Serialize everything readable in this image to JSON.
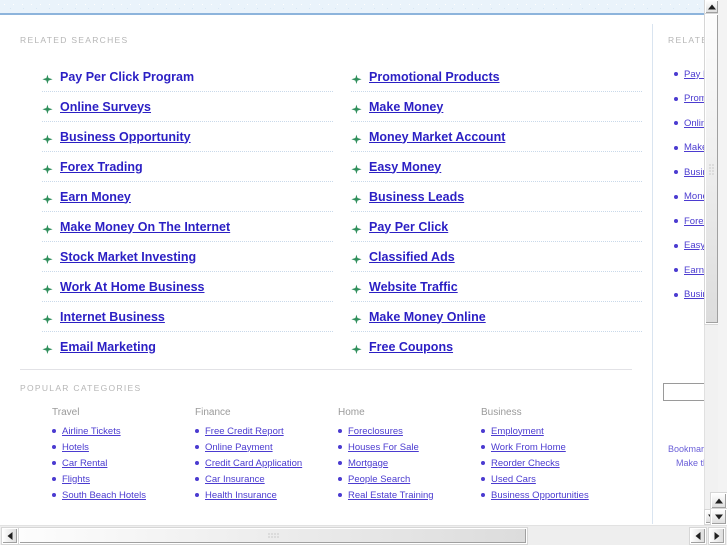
{
  "colors": {
    "banner_bg": "#eaf3fb",
    "banner_border": "#8db4dc",
    "link": "#2b1fc4",
    "small_link": "#4b3bd0",
    "label_gray": "#b6b6b6",
    "marker_green": "#2f8f5b",
    "divider": "#d9e4f0"
  },
  "related_searches": {
    "heading": "RELATED SEARCHES",
    "left_column": [
      "Pay Per Click Program",
      "Online Surveys",
      "Business Opportunity",
      "Forex Trading",
      "Earn Money",
      "Make Money On The Internet",
      "Stock Market Investing",
      "Work At Home Business",
      "Internet Business",
      "Email Marketing"
    ],
    "right_column": [
      "Promotional Products",
      "Make Money",
      "Money Market Account",
      "Easy Money",
      "Business Leads",
      "Pay Per Click",
      "Classified Ads",
      "Website Traffic",
      "Make Money Online",
      "Free Coupons"
    ]
  },
  "popular_categories": {
    "heading": "POPULAR CATEGORIES",
    "columns": [
      {
        "title": "Travel",
        "items": [
          "Airline Tickets",
          "Hotels",
          "Car Rental",
          "Flights",
          "South Beach Hotels"
        ]
      },
      {
        "title": "Finance",
        "items": [
          "Free Credit Report",
          "Online Payment",
          "Credit Card Application",
          "Car Insurance",
          "Health Insurance"
        ]
      },
      {
        "title": "Home",
        "items": [
          "Foreclosures",
          "Houses For Sale",
          "Mortgage",
          "People Search",
          "Real Estate Training"
        ]
      },
      {
        "title": "Business",
        "items": [
          "Employment",
          "Work From Home",
          "Reorder Checks",
          "Used Cars",
          "Business Opportunities"
        ]
      }
    ]
  },
  "sidebar": {
    "heading": "RELATED",
    "items": [
      "Pay Per Click Program",
      "Promotional Products",
      "Online Surveys",
      "Make Money",
      "Business Opportunity",
      "Money Market Account",
      "Forex Trading",
      "Easy Money",
      "Earn Money",
      "Business Leads"
    ],
    "search_value": "",
    "search_placeholder": "",
    "footer_line1": "Bookmark",
    "footer_line2": "Make this"
  },
  "scrollbars": {
    "up_arrow": "scroll-up",
    "down_arrow": "scroll-down",
    "left_arrow": "scroll-left",
    "right_arrow": "scroll-right"
  }
}
